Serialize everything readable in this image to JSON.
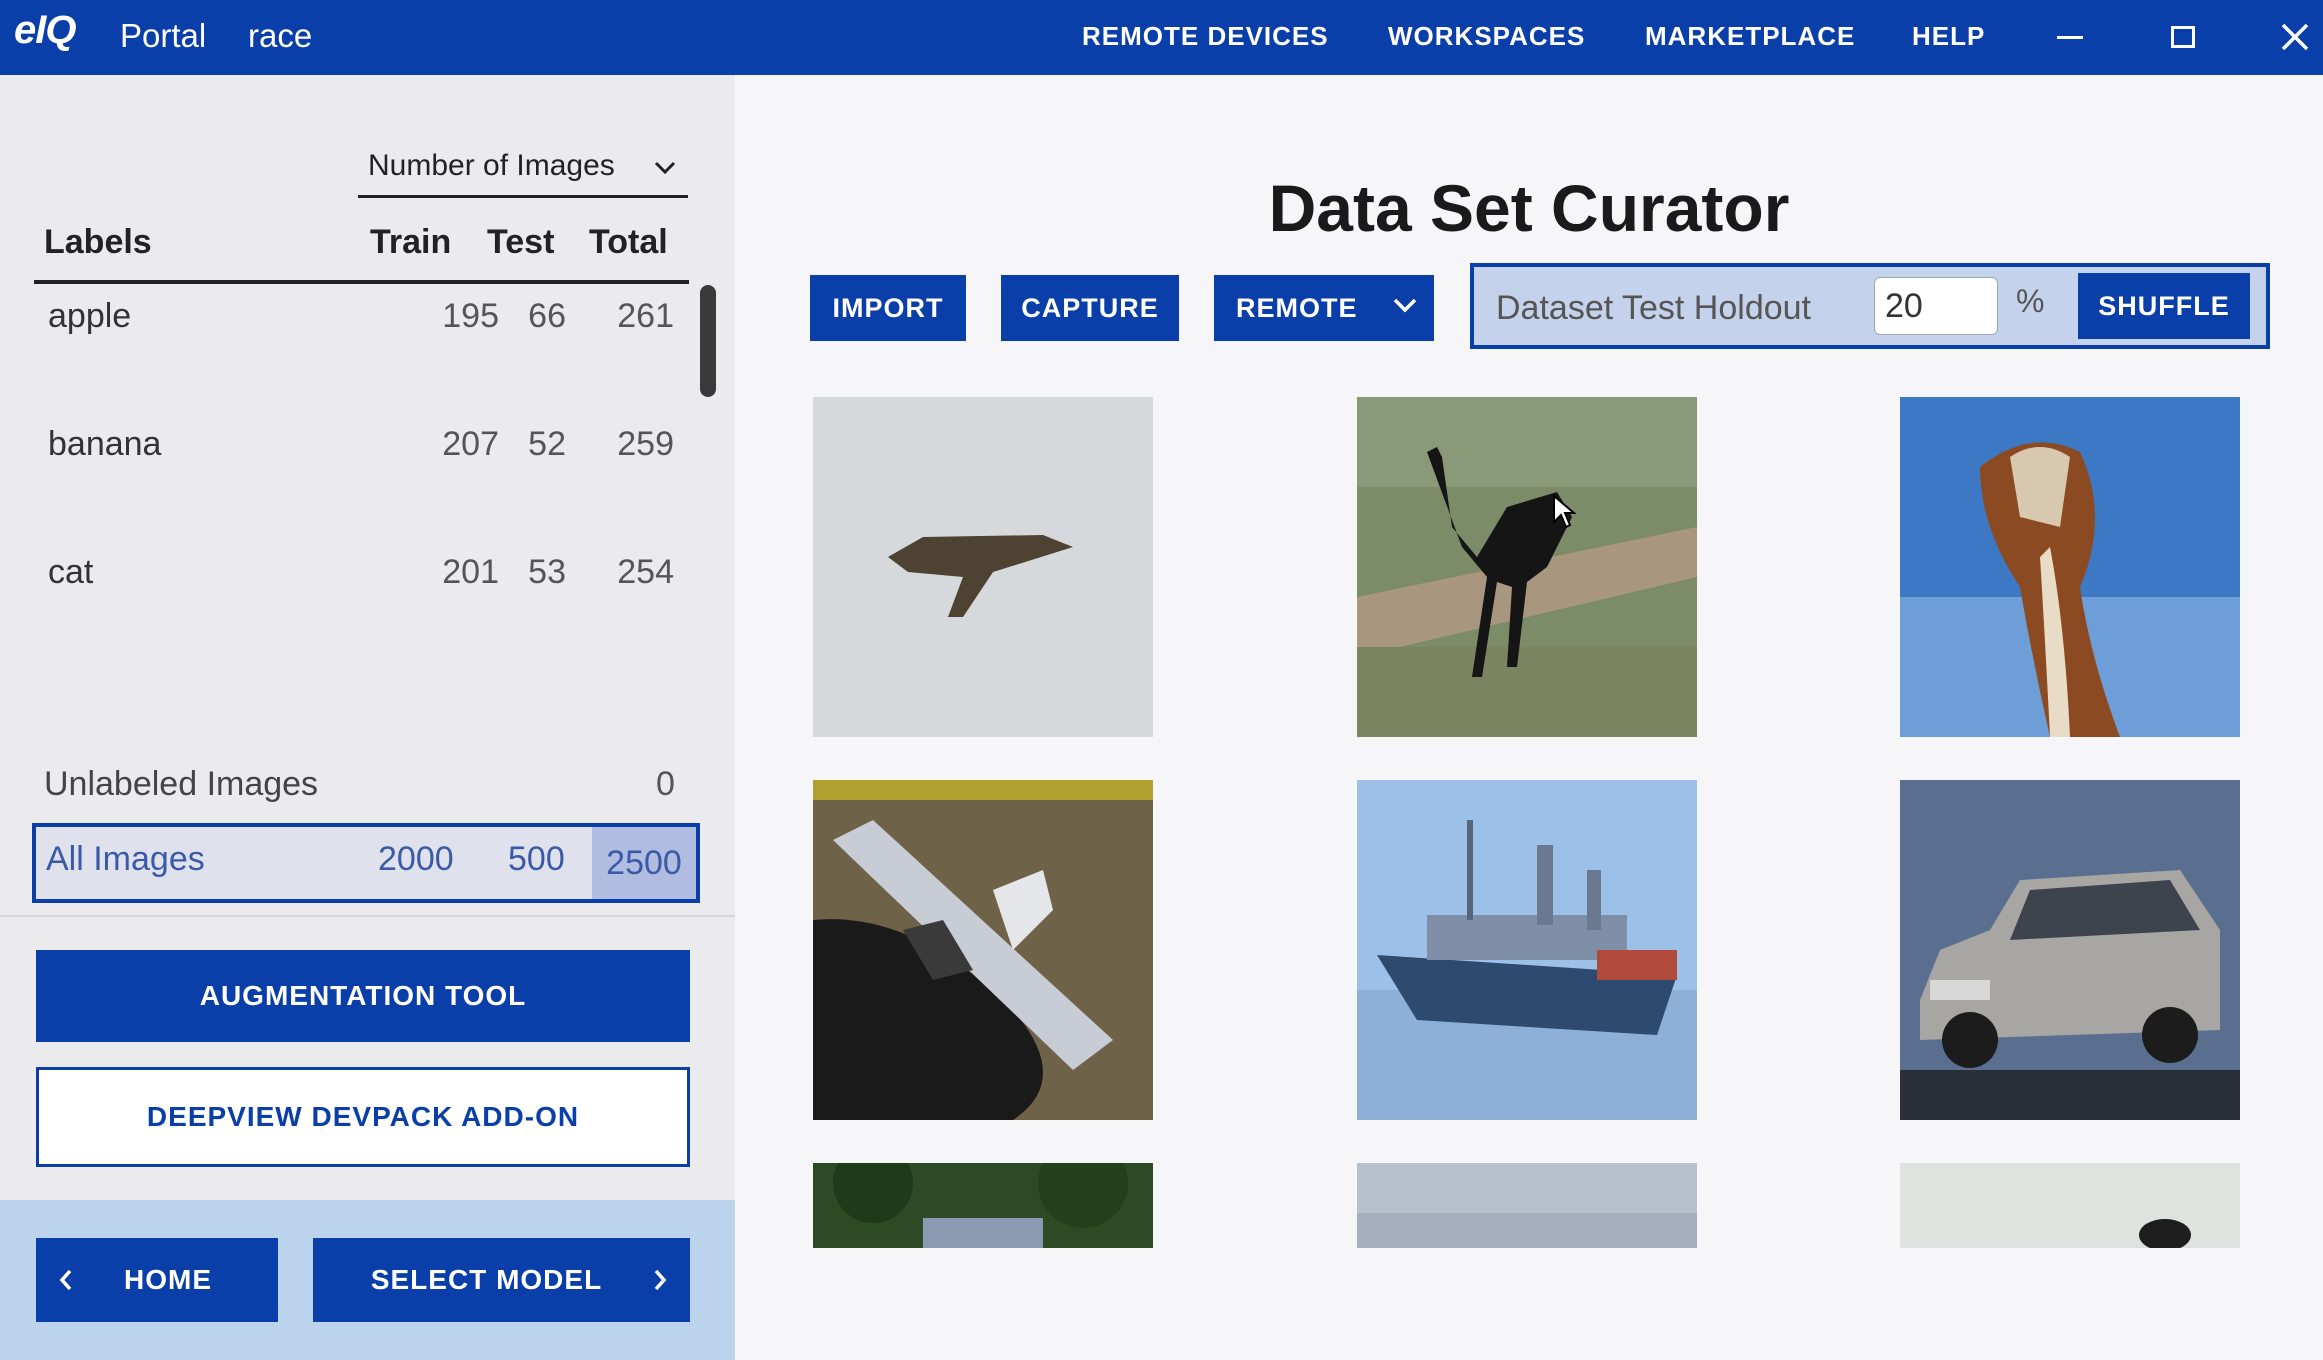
{
  "topbar": {
    "logo": "eIQ",
    "app_name": "Portal",
    "project_name": "race",
    "nav": [
      "REMOTE DEVICES",
      "WORKSPACES",
      "MARKETPLACE",
      "HELP"
    ]
  },
  "left_panel": {
    "sort_select": "Number of Images",
    "headers": {
      "labels": "Labels",
      "train": "Train",
      "test": "Test",
      "total": "Total"
    },
    "rows": [
      {
        "label": "apple",
        "train": "195",
        "test": "66",
        "total": "261"
      },
      {
        "label": "banana",
        "train": "207",
        "test": "52",
        "total": "259"
      },
      {
        "label": "cat",
        "train": "201",
        "test": "53",
        "total": "254"
      }
    ],
    "unlabeled": {
      "label": "Unlabeled Images",
      "count": "0"
    },
    "all_images": {
      "label": "All Images",
      "train": "2000",
      "test": "500",
      "total": "2500"
    },
    "augmentation_button": "AUGMENTATION TOOL",
    "devpack_button": "DEEPVIEW DEVPACK ADD-ON",
    "home_button": "HOME",
    "select_model_button": "SELECT MODEL"
  },
  "main": {
    "title": "Data Set Curator",
    "toolbar": {
      "import": "IMPORT",
      "capture": "CAPTURE",
      "remote": "REMOTE",
      "holdout_label": "Dataset Test Holdout",
      "holdout_value": "20",
      "holdout_unit": "%",
      "shuffle": "SHUFFLE"
    },
    "thumbnails": [
      "airplane-icon",
      "ostrich-icon",
      "bird-icon",
      "airplane-icon",
      "ship-icon",
      "car-icon",
      "tree-icon",
      "sky-icon",
      "bird-icon"
    ]
  },
  "colors": {
    "primary": "#0a3ea8",
    "highlight": "#b0bde0",
    "bottom_bar": "#bcd3ee"
  }
}
